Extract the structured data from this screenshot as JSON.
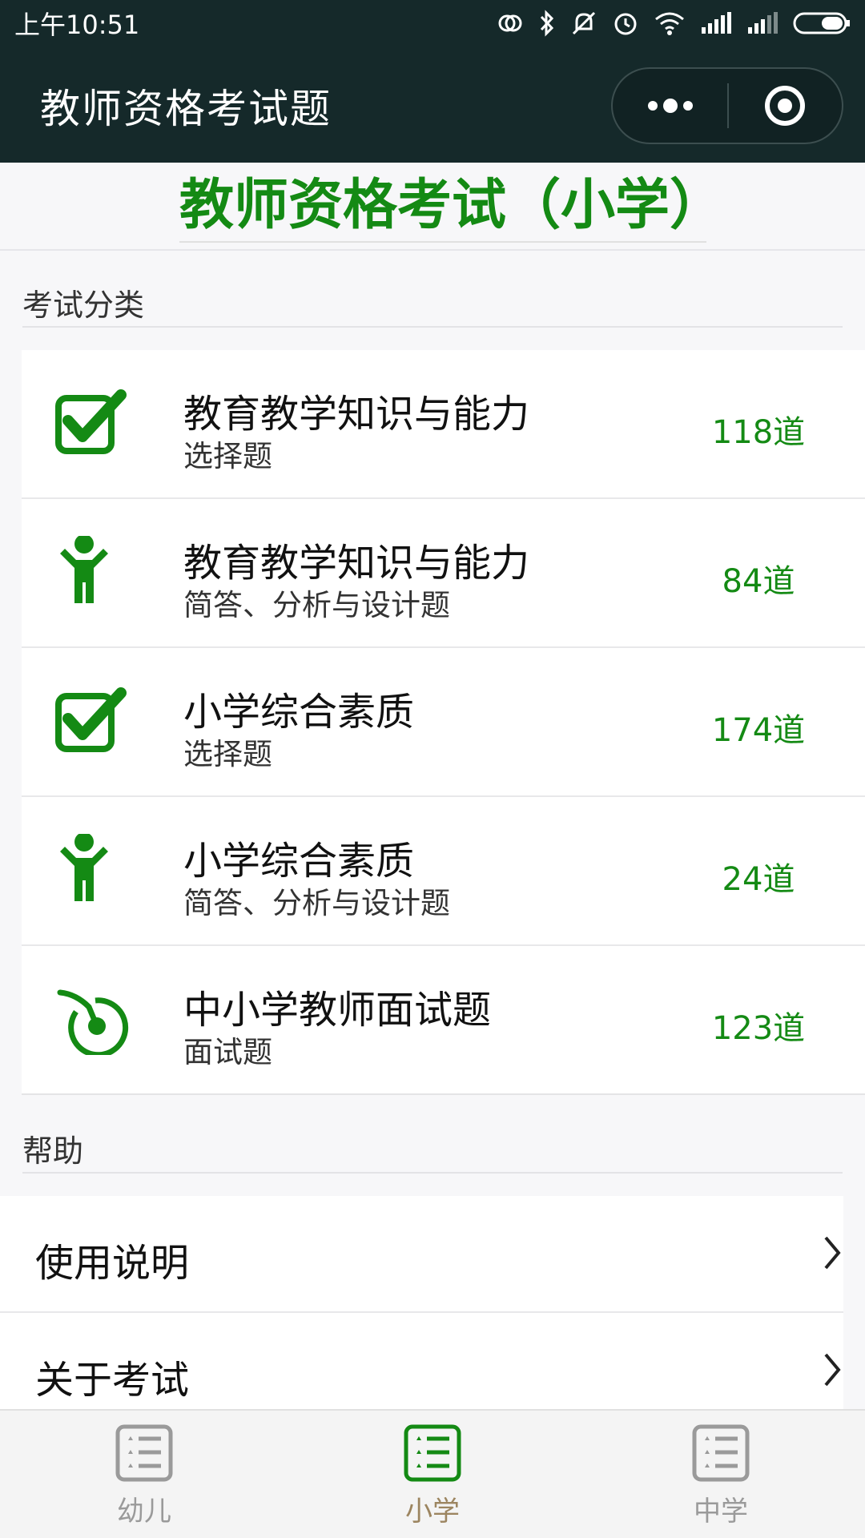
{
  "status_bar": {
    "time": "上午10:51"
  },
  "nav": {
    "title": "教师资格考试题"
  },
  "header": {
    "title": "教师资格考试（小学）"
  },
  "categories": {
    "section_label": "考试分类",
    "items": [
      {
        "title": "教育教学知识与能力",
        "subtitle": "选择题",
        "count": "118道",
        "icon": "checkbox-icon"
      },
      {
        "title": "教育教学知识与能力",
        "subtitle": "简答、分析与设计题",
        "count": "84道",
        "icon": "person-icon"
      },
      {
        "title": "小学综合素质",
        "subtitle": "选择题",
        "count": "174道",
        "icon": "checkbox-icon"
      },
      {
        "title": "小学综合素质",
        "subtitle": "简答、分析与设计题",
        "count": "24道",
        "icon": "person-icon"
      },
      {
        "title": "中小学教师面试题",
        "subtitle": "面试题",
        "count": "123道",
        "icon": "target-icon"
      }
    ]
  },
  "help": {
    "section_label": "帮助",
    "items": [
      {
        "label": "使用说明"
      },
      {
        "label": "关于考试"
      }
    ]
  },
  "tabbar": {
    "tabs": [
      {
        "label": "幼儿",
        "active": false
      },
      {
        "label": "小学",
        "active": true
      },
      {
        "label": "中学",
        "active": false
      }
    ]
  },
  "colors": {
    "accent": "#148a14",
    "nav_bg": "#15292a",
    "tab_active_label": "#9c8560"
  }
}
